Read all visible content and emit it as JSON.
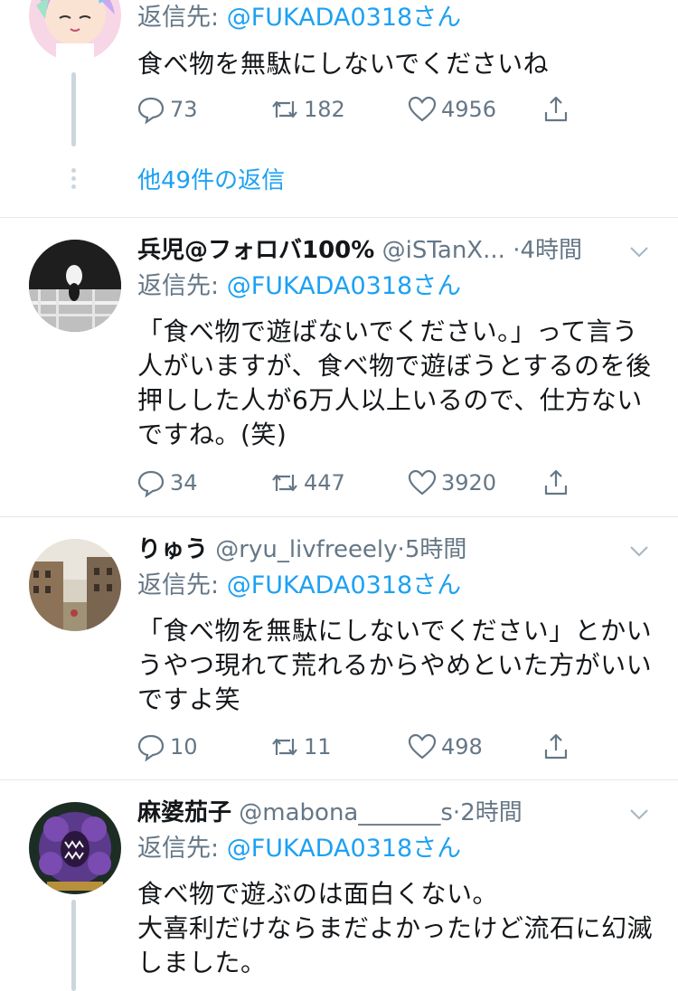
{
  "tweets": [
    {
      "name": "",
      "handle": "",
      "time": "",
      "reply_label": "返信先: ",
      "reply_mention": "@FUKADA0318さん",
      "text": "食べ物を無駄にしないでくださいね",
      "replies": "73",
      "retweets": "182",
      "likes": "4956"
    },
    {
      "name": "兵児@フォロバ100%",
      "handle": "@iSTanX...",
      "dot": "·",
      "time": "4時間",
      "reply_label": "返信先: ",
      "reply_mention": "@FUKADA0318さん",
      "text": "「食べ物で遊ばないでください。」って言う\n人がいますが、食べ物で遊ぼうとするのを後\n押しした人が6万人以上いるので、仕方ない\nですね。(笑)",
      "replies": "34",
      "retweets": "447",
      "likes": "3920"
    },
    {
      "name": "りゅう",
      "handle": "@ryu_livfreeely",
      "dot": "·",
      "time": "5時間",
      "reply_label": "返信先: ",
      "reply_mention": "@FUKADA0318さん",
      "text": "「食べ物を無駄にしないでください」とかい\nうやつ現れて荒れるからやめといた方がいい\nですよ笑",
      "replies": "10",
      "retweets": "11",
      "likes": "498"
    },
    {
      "name": "麻婆茄子",
      "handle": "@mabona_______s",
      "dot": "·",
      "time": "2時間",
      "reply_label": "返信先: ",
      "reply_mention": "@FUKADA0318さん",
      "text": "食べ物で遊ぶのは面白くない。\n大喜利だけならまだよかったけど流石に幻滅\nしました。"
    }
  ],
  "thread": {
    "more_replies": "他49件の返信"
  },
  "colors": {
    "link": "#1da1f2",
    "secondary": "#657786",
    "divider": "#e1e8ed",
    "thread_line": "#ccd6dd"
  },
  "icons": [
    "reply-icon",
    "retweet-icon",
    "like-icon",
    "share-icon",
    "chevron-down-icon"
  ]
}
